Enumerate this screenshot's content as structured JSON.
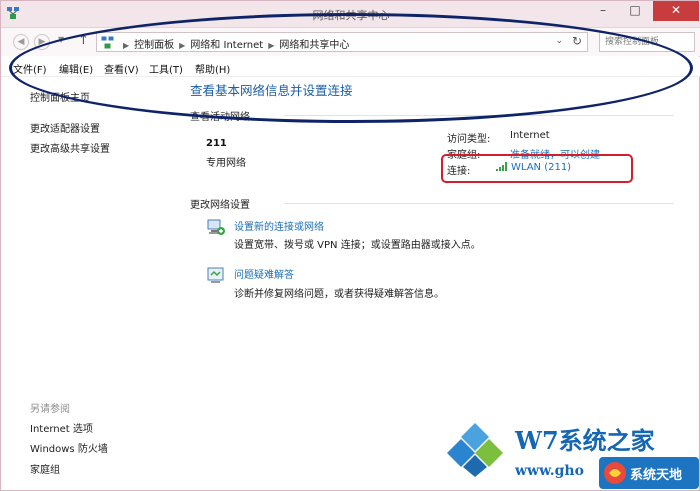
{
  "window": {
    "title": "网络和共享中心",
    "minimize": "–",
    "maximize": "□",
    "close": "✕"
  },
  "address": {
    "breadcrumbs": [
      "控制面板",
      "网络和 Internet",
      "网络和共享中心"
    ],
    "search_placeholder": "搜索控制面板"
  },
  "menu": [
    "文件(F)",
    "编辑(E)",
    "查看(V)",
    "工具(T)",
    "帮助(H)"
  ],
  "sidebar": {
    "items": [
      "控制面板主页",
      "更改适配器设置",
      "更改高级共享设置"
    ],
    "see_also_title": "另请参阅",
    "see_also": [
      "Internet 选项",
      "Windows 防火墙",
      "家庭组"
    ]
  },
  "main": {
    "title": "查看基本网络信息并设置连接",
    "active_networks_header": "查看活动网络",
    "network_name": "211",
    "network_type": "专用网络",
    "access_type_label": "访问类型:",
    "access_type_value": "Internet",
    "homegroup_label": "家庭组:",
    "homegroup_value": "准备就绪，可以创建",
    "connection_label": "连接:",
    "connection_value": "WLAN (211)",
    "change_settings_header": "更改网络设置",
    "tasks": [
      {
        "link": "设置新的连接或网络",
        "desc": "设置宽带、拨号或 VPN 连接；或设置路由器或接入点。"
      },
      {
        "link": "问题疑难解答",
        "desc": "诊断并修复网络问题，或者获得疑难解答信息。"
      }
    ]
  },
  "watermark": {
    "title": "W7系统之家",
    "url": "www.gho",
    "badge": "系统天地"
  },
  "colors": {
    "link": "#1b6fb6",
    "title_blue": "#1b5fa8",
    "annotation_oval": "#0f2468",
    "annotation_box": "#d01f2d",
    "close_button": "#c73c3c"
  }
}
